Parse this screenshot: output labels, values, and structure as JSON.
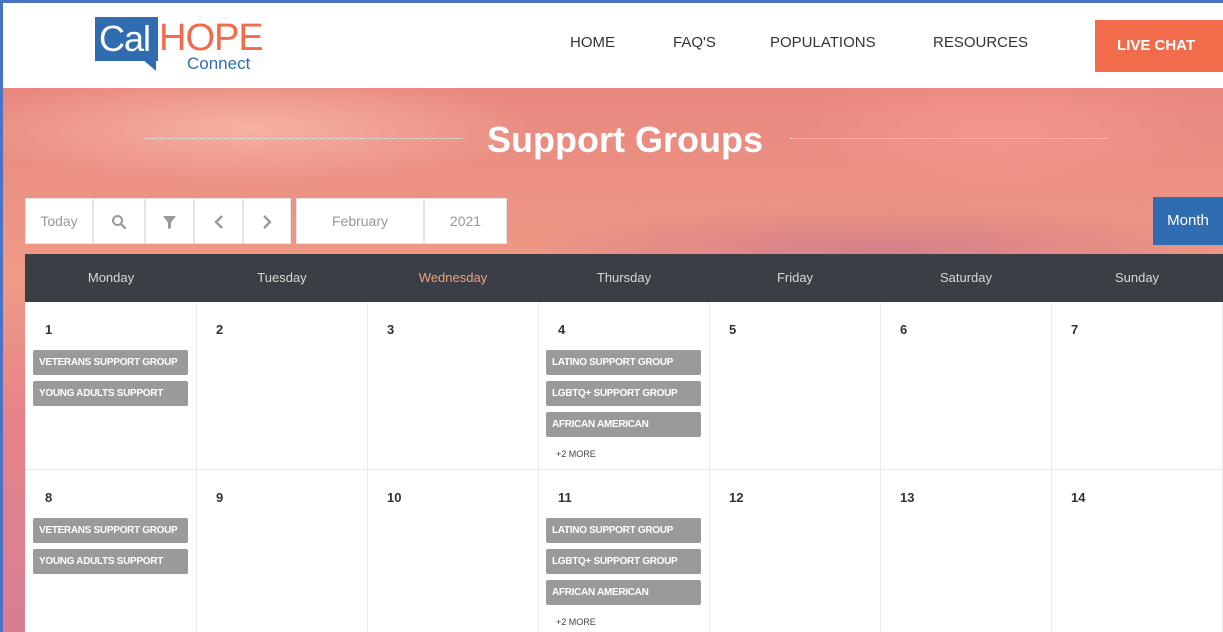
{
  "logo": {
    "cal": "Cal",
    "hope": "HOPE",
    "connect": "Connect"
  },
  "nav": {
    "home": "HOME",
    "faq": "FAQ'S",
    "populations": "POPULATIONS",
    "resources": "RESOURCES",
    "live_chat": "LIVE CHAT"
  },
  "hero": {
    "title": "Support Groups"
  },
  "toolbar": {
    "today": "Today",
    "month_value": "February",
    "year_value": "2021",
    "view_button": "Month"
  },
  "calendar": {
    "days": [
      "Monday",
      "Tuesday",
      "Wednesday",
      "Thursday",
      "Friday",
      "Saturday",
      "Sunday"
    ],
    "highlight_day": "Wednesday",
    "weeks": [
      {
        "dates": [
          "1",
          "2",
          "3",
          "4",
          "5",
          "6",
          "7"
        ],
        "events": {
          "monday": [
            "VETERANS SUPPORT GROUP",
            "YOUNG ADULTS SUPPORT"
          ],
          "thursday": [
            "LATINO SUPPORT GROUP",
            "LGBTQ+ SUPPORT GROUP",
            "AFRICAN AMERICAN"
          ],
          "thursday_more": "+2 MORE"
        }
      },
      {
        "dates": [
          "8",
          "9",
          "10",
          "11",
          "12",
          "13",
          "14"
        ],
        "events": {
          "monday": [
            "VETERANS SUPPORT GROUP",
            "YOUNG ADULTS SUPPORT"
          ],
          "thursday": [
            "LATINO SUPPORT GROUP",
            "LGBTQ+ SUPPORT GROUP",
            "AFRICAN AMERICAN"
          ],
          "thursday_more": "+2 MORE"
        }
      }
    ]
  },
  "colors": {
    "brand_blue": "#2f6db0",
    "brand_orange": "#f26b4a",
    "header_dark": "#3b3f45",
    "event_gray": "#9a9a9a"
  }
}
